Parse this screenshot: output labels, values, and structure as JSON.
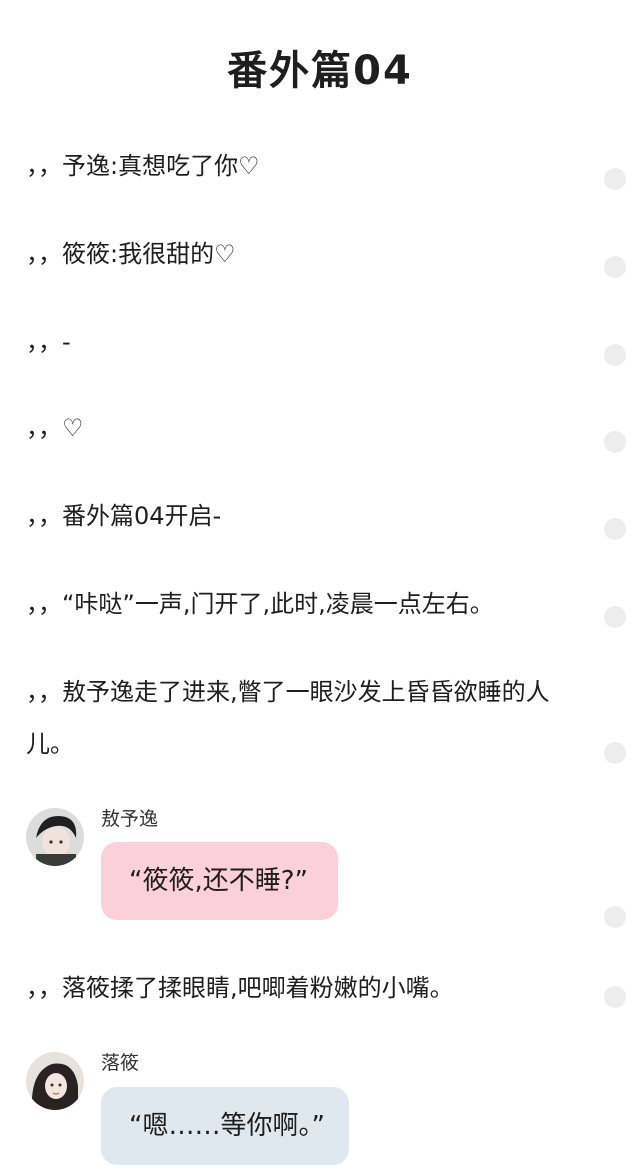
{
  "title": "番外篇04",
  "lines": [
    "，，予逸:真想吃了你♡",
    "，，筱筱:我很甜的♡",
    "，，-",
    "，，♡",
    "，，番外篇04开启-",
    "，，“咔哒”一声,门开了,此时,凌晨一点左右。",
    "，，敖予逸走了进来,瞥了一眼沙发上昏昏欲睡的人儿。",
    "，，落筱揉了揉眼睛,吧唧着粉嫩的小嘴。"
  ],
  "messages": [
    {
      "name": "敖予逸",
      "text": "“筱筱,还不睡?”",
      "bubble_color": "#fbd0da",
      "avatar_icon": "boy-avatar"
    },
    {
      "name": "落筱",
      "text": "“嗯……等你啊。”",
      "bubble_color": "#dfe8ef",
      "avatar_icon": "girl-avatar"
    }
  ],
  "colors": {
    "text": "#1e1e1e",
    "dot": "#ededed",
    "background": "#ffffff"
  }
}
